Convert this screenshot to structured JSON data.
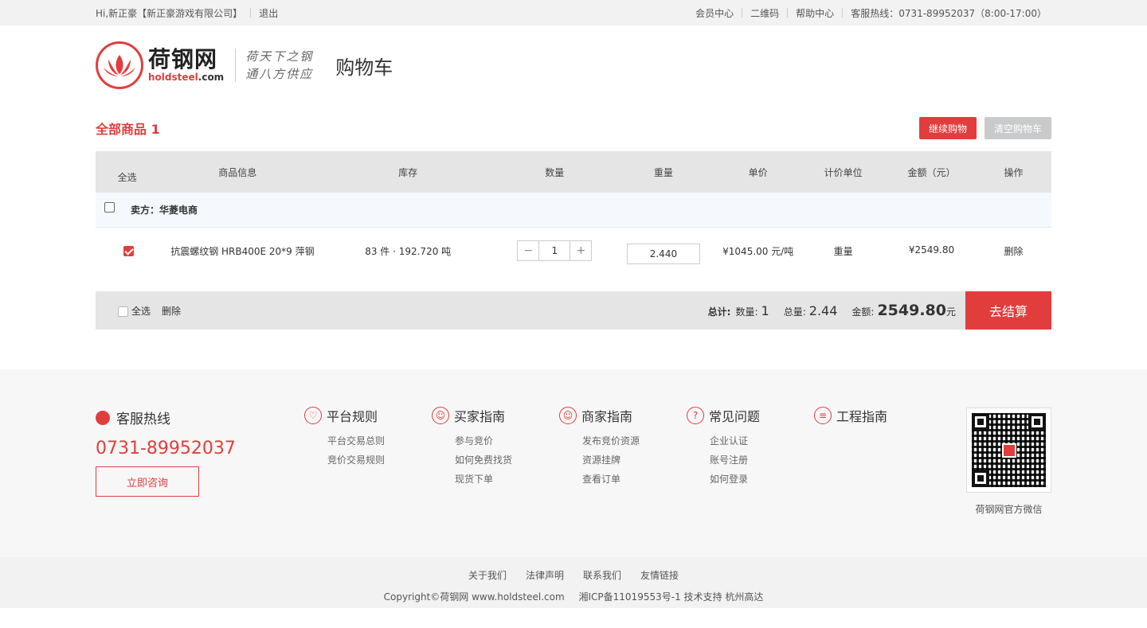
{
  "topbar": {
    "greeting": "Hi,新正豪【新正豪游戏有限公司】",
    "logout": "退出",
    "links": [
      "会员中心",
      "二维码",
      "帮助中心"
    ],
    "hotline": "客服热线：0731-89952037（8:00-17:00）"
  },
  "header": {
    "logo_cn": "荷钢网",
    "logo_en_a": "holdsteel",
    "logo_en_b": ".com",
    "slogan_1": "荷天下之钢",
    "slogan_2": "通八方供应",
    "page_title": "购物车"
  },
  "cart": {
    "count_label": "全部商品 1",
    "continue_btn": "继续购物",
    "clear_btn": "清空购物车",
    "columns": [
      "全选",
      "商品信息",
      "库存",
      "数量",
      "重量",
      "单价",
      "计价单位",
      "金额（元）",
      "操作"
    ],
    "seller": "卖方：华菱电商",
    "item": {
      "name": "抗震螺纹钢 HRB400E 20*9 萍钢",
      "stock": "83 件 · 192.720 吨",
      "quantity": "1",
      "weight": "2.440",
      "price": "¥1045.00 元/吨",
      "unit": "重量",
      "amount": "¥2549.80",
      "delete": "删除"
    }
  },
  "summary": {
    "select_all": "全选",
    "delete": "删除",
    "total_label": "总计:",
    "qty_label": "数量:",
    "qty": "1",
    "weight_label": "总量:",
    "weight": "2.44",
    "amount_label": "金额:",
    "amount": "2549.80",
    "currency": "元",
    "checkout": "去结算"
  },
  "footer": {
    "hotline_title": "客服热线",
    "hotline_number": "0731-89952037",
    "consult": "立即咨询",
    "columns": [
      {
        "title": "平台规则",
        "icon": "shield-icon",
        "items": [
          "平台交易总则",
          "竞价交易规则"
        ]
      },
      {
        "title": "买家指南",
        "icon": "buyer-icon",
        "items": [
          "参与竞价",
          "如何免费找货",
          "现货下单"
        ]
      },
      {
        "title": "商家指南",
        "icon": "seller-icon",
        "items": [
          "发布竞价资源",
          "资源挂牌",
          "查看订单"
        ]
      },
      {
        "title": "常见问题",
        "icon": "question-icon",
        "items": [
          "企业认证",
          "账号注册",
          "如何登录"
        ]
      },
      {
        "title": "工程指南",
        "icon": "document-icon",
        "items": []
      }
    ],
    "qr_caption": "荷钢网官方微信",
    "bottom_links": [
      "关于我们",
      "法律声明",
      "联系我们",
      "友情链接"
    ],
    "copyright": "Copyright©荷钢网 www.holdsteel.com",
    "icp": "湘ICP备11019553号-1 技术支持 杭州高达"
  },
  "colors": {
    "accent": "#e23d3d",
    "gray_button": "#c9cacc"
  }
}
